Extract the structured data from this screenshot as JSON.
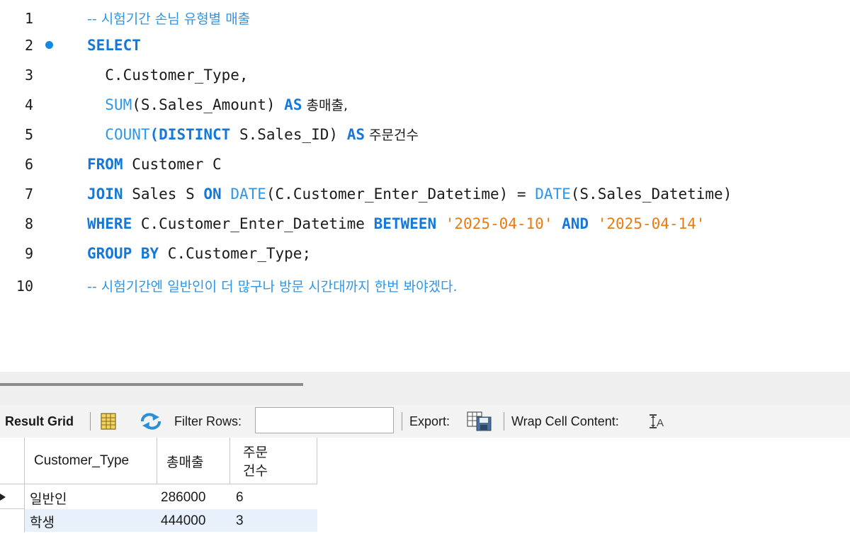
{
  "editor": {
    "lines": [
      {
        "num": "1",
        "comment": "-- 시험기간 손님 유형별 매출"
      },
      {
        "num": "2",
        "kw": "SELECT",
        "breakpoint": true
      },
      {
        "num": "3",
        "text": "  C.Customer_Type,"
      },
      {
        "num": "4",
        "fn": "SUM",
        "text_a": "(S.Sales_Amount) ",
        "kw": "AS",
        "kr": " 총매출,"
      },
      {
        "num": "5",
        "fn": "COUNT",
        "kw_a": "(DISTINCT",
        "text_a": " S.Sales_ID) ",
        "kw_b": "AS",
        "kr": " 주문건수"
      },
      {
        "num": "6",
        "kw": "FROM",
        "text": " Customer C"
      },
      {
        "num": "7",
        "kw_a": "JOIN",
        "text_a": " Sales S ",
        "kw_b": "ON",
        "fn_a": " DATE",
        "text_b": "(C.Customer_Enter_Datetime) = ",
        "fn_b": "DATE",
        "text_c": "(S.Sales_Datetime)"
      },
      {
        "num": "8",
        "kw_a": "WHERE",
        "text_a": " C.Customer_Enter_Datetime ",
        "kw_b": "BETWEEN",
        "str_a": " '2025-04-10'",
        "kw_c": " AND",
        "str_b": " '2025-04-14'"
      },
      {
        "num": "9",
        "kw": "GROUP BY",
        "text": " C.Customer_Type;"
      },
      {
        "num": "10",
        "comment": "-- 시험기간엔 일반인이 더 많구나 방문 시간대까지 한번 봐야겠다."
      }
    ]
  },
  "toolbar": {
    "result_grid": "Result Grid",
    "filter_rows": "Filter Rows:",
    "filter_value": "",
    "export": "Export:",
    "wrap_cell": "Wrap Cell Content:",
    "wrap_icon_text": "A"
  },
  "grid": {
    "columns": [
      "Customer_Type",
      "총매출",
      "주문",
      "건수"
    ],
    "rows": [
      {
        "type": "일반인",
        "total": "286000",
        "count": "6"
      },
      {
        "type": "학생",
        "total": "444000",
        "count": "3"
      }
    ]
  },
  "colors": {
    "keyword": "#1578d8",
    "function": "#2e96e8",
    "string": "#ea7a10",
    "comment": "#2e96e8",
    "breakpoint": "#1688e0",
    "selected_row": "#e8f1fb"
  },
  "icons": [
    "breakpoint-dot-icon",
    "result-grid-icon",
    "refresh-icon",
    "export-icon",
    "wrap-cell-icon",
    "current-row-arrow-icon"
  ]
}
